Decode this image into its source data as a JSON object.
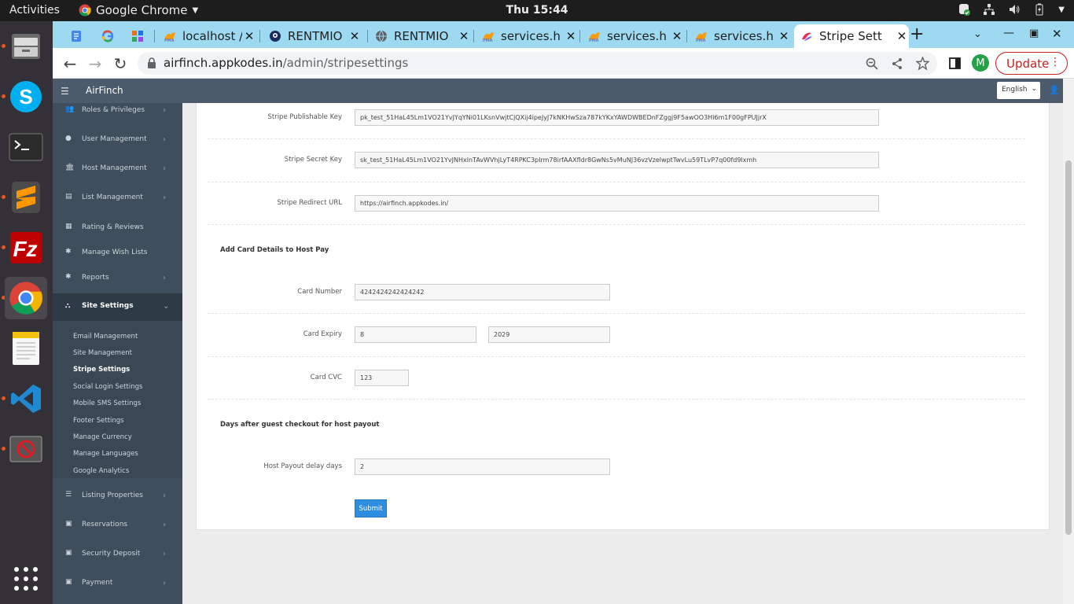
{
  "system": {
    "activities_label": "Activities",
    "app_name": "Google Chrome",
    "clock": "Thu 15:44"
  },
  "dock": {
    "items": [
      "files-icon",
      "skype-icon",
      "terminal-icon",
      "sublime-text-icon",
      "filezilla-icon",
      "chrome-icon",
      "text-editor-icon",
      "vscode-icon",
      "blocked-app-icon",
      "show-apps-icon"
    ]
  },
  "browser": {
    "tabs": [
      {
        "label": "",
        "icon": "docs-icon"
      },
      {
        "label": "",
        "icon": "google-icon"
      },
      {
        "label": "",
        "icon": "extension-icon"
      },
      {
        "label": "localhost /",
        "icon": "phpmyadmin-icon"
      },
      {
        "label": "RENTMIO",
        "icon": "rentmio-icon"
      },
      {
        "label": "RENTMIO",
        "icon": "globe-icon"
      },
      {
        "label": "services.h",
        "icon": "phpmyadmin-icon"
      },
      {
        "label": "services.h",
        "icon": "phpmyadmin-icon"
      },
      {
        "label": "services.h",
        "icon": "phpmyadmin-icon"
      },
      {
        "label": "Stripe Sett",
        "icon": "stripe-icon"
      }
    ],
    "url_host": "airfinch.appkodes.in",
    "url_path": "/admin/stripesettings",
    "profile_initial": "M",
    "update_label": "Update"
  },
  "admin": {
    "brand": "AirFinch",
    "language": "English",
    "sidebar": [
      {
        "label": "Roles & Privileges",
        "icon": "users-icon"
      },
      {
        "label": "User Management",
        "icon": "user-icon"
      },
      {
        "label": "Host Management",
        "icon": "bank-icon"
      },
      {
        "label": "List Management",
        "icon": "list-icon"
      },
      {
        "label": "Rating & Reviews",
        "icon": "review-icon"
      },
      {
        "label": "Manage Wish Lists",
        "icon": "gear-icon"
      },
      {
        "label": "Reports",
        "icon": "gear-icon"
      },
      {
        "label": "Site Settings",
        "icon": "sitemap-icon"
      },
      {
        "label": "Listing Properties",
        "icon": "menu-icon"
      },
      {
        "label": "Reservations",
        "icon": "money-icon"
      },
      {
        "label": "Security Deposit",
        "icon": "money-icon"
      },
      {
        "label": "Payment",
        "icon": "money-icon"
      }
    ],
    "site_settings_submenu": [
      "Email Management",
      "Site Management",
      "Stripe Settings",
      "Social Login Settings",
      "Mobile SMS Settings",
      "Footer Settings",
      "Manage Currency",
      "Manage Languages",
      "Google Analytics"
    ],
    "selected_submenu": "Stripe Settings"
  },
  "form": {
    "publishable_key_label": "Stripe Publishable Key",
    "publishable_key_value": "pk_test_51HaL45Lm1VO21YvJYqYNi01LKsnVwjtCjQXij4ipeJyJ7kNKHwSza787kYKxYAWDWBEDnFZggj9F5awOO3Hi6m1F00gFPUJjrX",
    "secret_key_label": "Stripe Secret Key",
    "secret_key_value": "sk_test_51HaL45Lm1VO21YvJNHxlnTAvWVhjLyT4RPKC3pIrm78irfAAXfldr8GwNs5vMuNJ36vzVzelwptTwvLu59TLvP7q00fd9lxmh",
    "redirect_url_label": "Stripe Redirect URL",
    "redirect_url_value": "https://airfinch.appkodes.in/",
    "card_section_title": "Add Card Details to Host Pay",
    "card_number_label": "Card Number",
    "card_number_value": "4242424242424242",
    "card_expiry_label": "Card Expiry",
    "card_expiry_month": "8",
    "card_expiry_year": "2029",
    "card_cvc_label": "Card CVC",
    "card_cvc_value": "123",
    "payout_section_title": "Days after guest checkout for host payout",
    "payout_delay_label": "Host Payout delay days",
    "payout_delay_value": "2",
    "submit_label": "Submit"
  }
}
